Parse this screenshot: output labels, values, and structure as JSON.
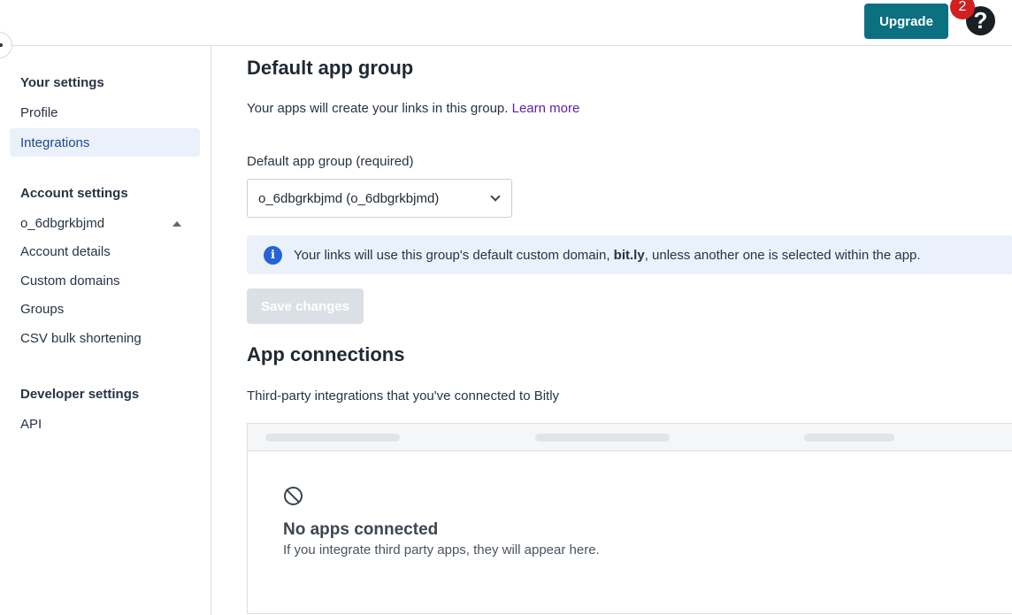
{
  "header": {
    "upgrade_label": "Upgrade",
    "notification_count": "2",
    "help_glyph": "?"
  },
  "sidebar": {
    "your_settings_heading": "Your settings",
    "your_settings_items": [
      "Profile",
      "Integrations"
    ],
    "active_item": "Integrations",
    "account_settings_heading": "Account settings",
    "org_name": "o_6dbgrkbjmd",
    "account_items": [
      "Account details",
      "Custom domains",
      "Groups",
      "CSV bulk shortening"
    ],
    "developer_settings_heading": "Developer settings",
    "developer_items": [
      "API"
    ]
  },
  "main": {
    "default_group": {
      "title": "Default app group",
      "description": "Your apps will create your links in this group.",
      "learn_more": "Learn more",
      "field_label": "Default app group (required)",
      "selected_value": "o_6dbgrkbjmd (o_6dbgrkbjmd)",
      "info_prefix": "Your links will use this group's default custom domain,",
      "info_domain": "bit.ly",
      "info_suffix": ", unless another one is selected within the app.",
      "save_label": "Save changes"
    },
    "connections": {
      "title": "App connections",
      "description": "Third-party integrations that you've connected to Bitly",
      "empty_title": "No apps connected",
      "empty_text": "If you integrate third party apps, they will appear here."
    }
  },
  "icons": {
    "info": "info-icon",
    "empty": "no-entry-icon",
    "dropdown": "chevron-down-icon",
    "org_toggle": "caret-up-icon"
  },
  "colors": {
    "brand": "#0c7081",
    "badge": "#d21f1f",
    "active_bg": "#eaf1fb",
    "link": "#5b1fa8",
    "info_icon": "#2563d6"
  }
}
